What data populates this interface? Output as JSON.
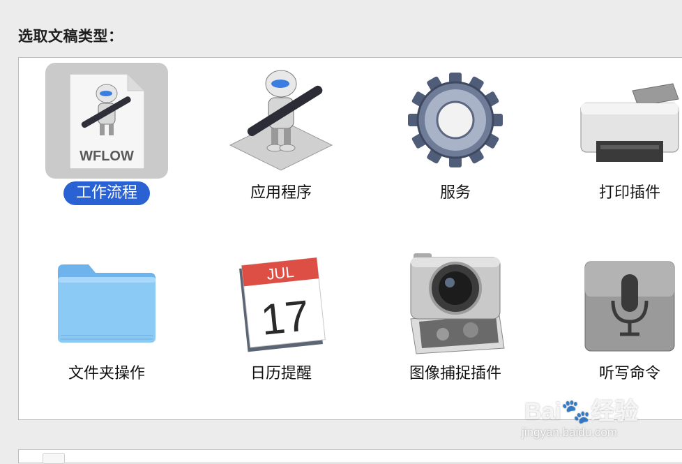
{
  "dialog": {
    "heading": "选取文稿类型："
  },
  "document_types": [
    {
      "label": "工作流程",
      "icon": "workflow-file-icon",
      "badge": "WFLOW",
      "selected": true
    },
    {
      "label": "应用程序",
      "icon": "automator-robot-icon",
      "selected": false
    },
    {
      "label": "服务",
      "icon": "gear-icon",
      "selected": false
    },
    {
      "label": "打印插件",
      "icon": "printer-icon",
      "selected": false
    },
    {
      "label": "文件夹操作",
      "icon": "folder-icon",
      "selected": false
    },
    {
      "label": "日历提醒",
      "icon": "calendar-icon",
      "month": "JUL",
      "day": "17",
      "selected": false
    },
    {
      "label": "图像捕捉插件",
      "icon": "camera-icon",
      "selected": false
    },
    {
      "label": "听写命令",
      "icon": "microphone-icon",
      "selected": false
    }
  ],
  "watermark": {
    "brand": "Bai",
    "brand_suffix": "经验",
    "url": "jingyan.baidu.com"
  },
  "colors": {
    "selection": "#2a62d4",
    "selected_tile": "#cacaca",
    "panel_background": "#ffffff",
    "window_background": "#ececec"
  }
}
